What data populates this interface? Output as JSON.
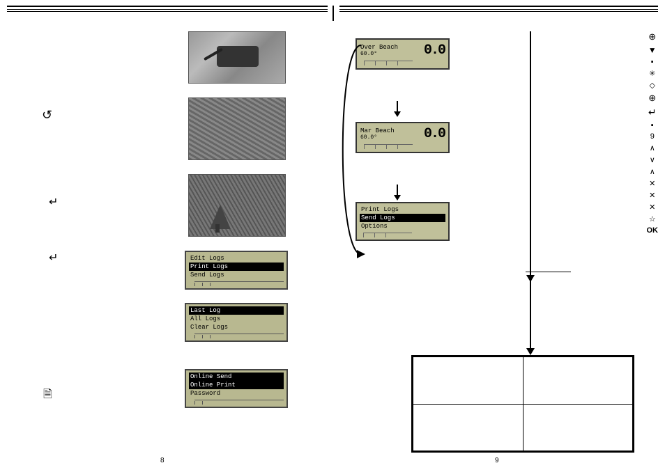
{
  "header": {
    "lines": 3
  },
  "left_page": {
    "icons": [
      "↺",
      "↵",
      "↵",
      "⬛"
    ],
    "screens": [
      {
        "type": "photo",
        "label": "cable-photo"
      },
      {
        "type": "photo",
        "label": "device-photo"
      },
      {
        "type": "photo",
        "label": "outdoor-photo"
      },
      {
        "type": "lcd",
        "label": "edit-logs-screen",
        "items": [
          "Edit Logs",
          "Print Logs",
          "Send Logs"
        ],
        "selected": 1
      },
      {
        "type": "lcd",
        "label": "last-log-screen",
        "items": [
          "Last Log",
          "All Logs",
          "Clear Logs"
        ],
        "selected": 0
      },
      {
        "type": "lcd",
        "label": "online-screen",
        "items": [
          "Online Send",
          "Online Print",
          "Password"
        ],
        "selected": 0
      }
    ],
    "page_num": "8"
  },
  "right_page": {
    "flow_screens": [
      {
        "id": "screen1",
        "type": "value",
        "line1": "Over Beach",
        "line2": "60.0°",
        "value": "0.0",
        "connectors": true
      },
      {
        "id": "screen2",
        "type": "value",
        "line1": "Mar Beach",
        "line2": "60.0°",
        "value": "0.0",
        "connectors": true
      },
      {
        "id": "screen3",
        "type": "menu",
        "items": [
          "Print Logs",
          "Send Logs",
          "Options"
        ],
        "selected": 1,
        "connectors": true
      }
    ],
    "sidebar_icons": [
      "⊕",
      "▼",
      "⬛",
      "⁂",
      "◇",
      "⊕",
      "↵",
      "⬛",
      "9",
      "∧",
      "∨",
      "∧",
      "×",
      "×",
      "×",
      "☆",
      "OK"
    ],
    "bottom_table": {
      "rows": 2,
      "cols": 2,
      "cells": [
        "",
        "",
        "",
        ""
      ]
    },
    "page_num": "9"
  }
}
